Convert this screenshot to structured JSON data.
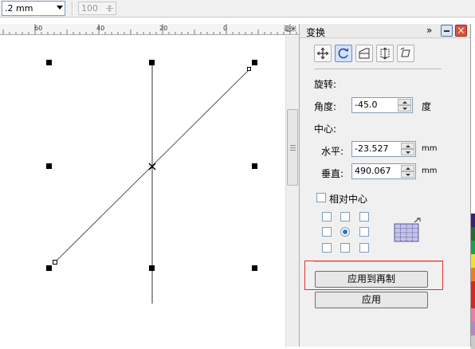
{
  "toolbar": {
    "outline_width": ".2 mm",
    "stepper_value": "100",
    "stepper_icon": "stepper-icon"
  },
  "ruler": {
    "labels": [
      "60",
      "40",
      "20",
      "0"
    ],
    "unit": "毫米"
  },
  "docker": {
    "title": "变换",
    "expand_icon": "»",
    "close_symbol": "×",
    "modes": [
      "position-icon",
      "rotate-icon",
      "scale-mirror-icon",
      "size-icon",
      "skew-icon"
    ],
    "rotation_heading": "旋转:",
    "angle_label": "角度:",
    "angle_value": "-45.0",
    "angle_unit": "度",
    "center_heading": "中心:",
    "horizontal_label": "水平:",
    "horizontal_value": "-23.527",
    "horizontal_unit": "mm",
    "vertical_label": "垂直:",
    "vertical_value": "490.067",
    "vertical_unit": "mm",
    "relative_center_label": "相对中心",
    "relative_center_checked": false,
    "anchor_selected": "center",
    "apply_duplicate_label": "应用到再制",
    "apply_label": "应用",
    "highlight_color": "#e03030"
  },
  "palette": {
    "colors": [
      "#ffffff",
      "#ffffff",
      "#ffffff",
      "#ffffff",
      "#ffffff",
      "#ffffff",
      "#ffffff",
      "#ffffff",
      "#ffffff",
      "#ffffff",
      "#ffffff",
      "#ffffff",
      "#ffffff",
      "#ffffff",
      "#3b1f7a",
      "#1f6e2a",
      "#17a34a",
      "#f1e41f",
      "#f07c1e",
      "#e1251b",
      "#e1251b",
      "#f07aa8",
      "#b388c0",
      "#c9c9c9"
    ]
  }
}
